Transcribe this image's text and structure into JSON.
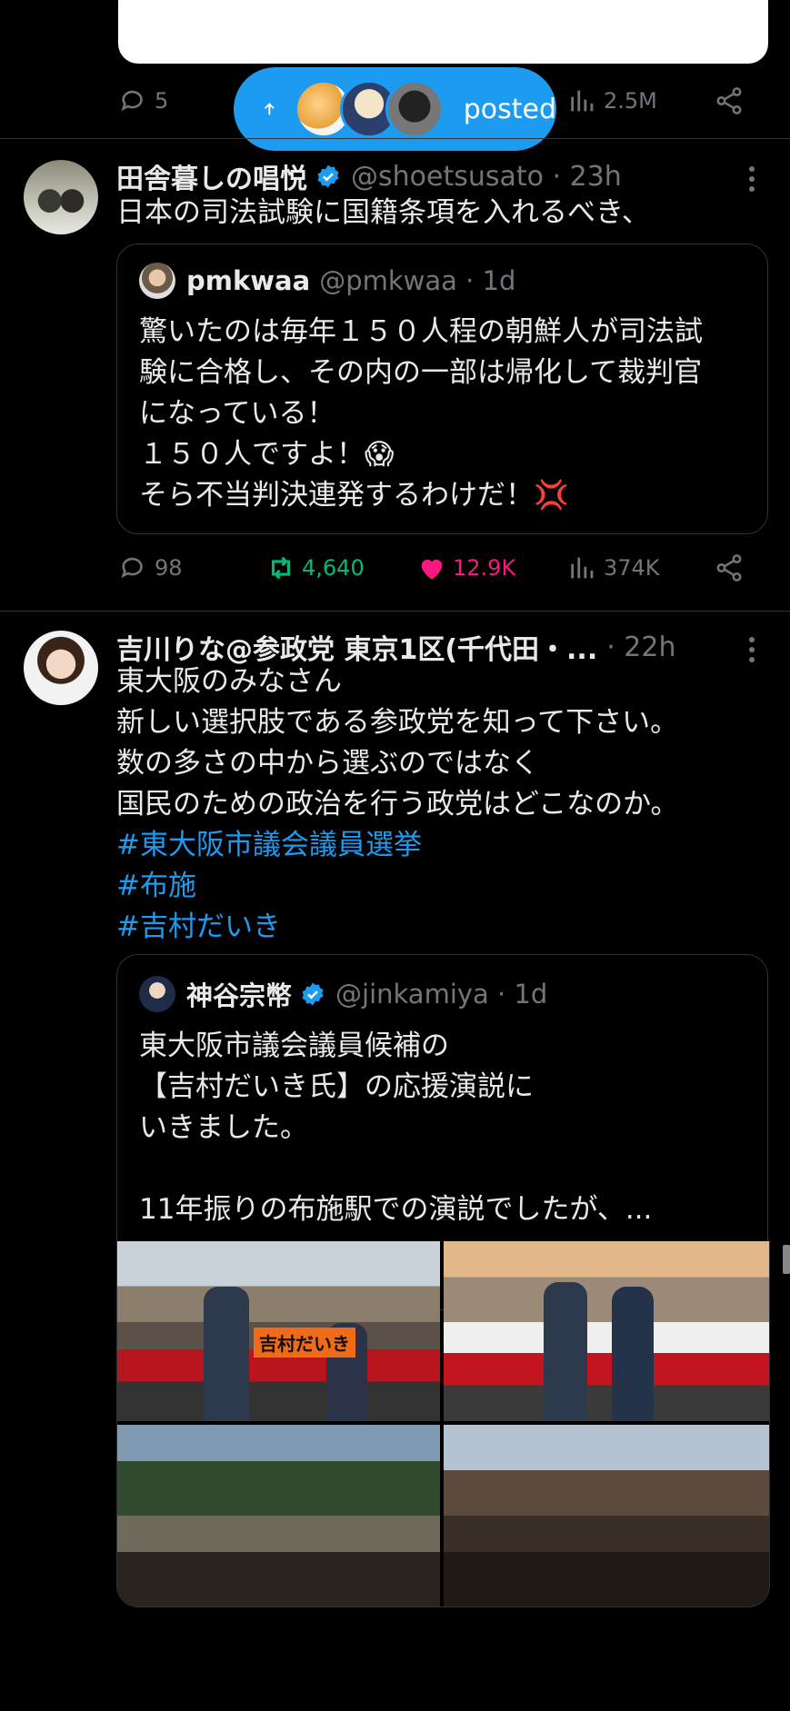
{
  "prev_tweet": {
    "replies": "5",
    "views": "2.5M"
  },
  "posted_pill": {
    "label": "posted",
    "icon": "arrow-up-icon"
  },
  "tweet1": {
    "name": "田舎暮しの唱悦",
    "handle": "@shoetsusato · 23h",
    "text": "日本の司法試験に国籍条項を入れるべき、",
    "quote": {
      "name": "pmkwaa",
      "handle": "@pmkwaa · 1d",
      "text": "驚いたのは毎年１５０人程の朝鮮人が司法試\n験に合格し、その内の一部は帰化して裁判官\nになっている！\n１５０人ですよ！😱\nそら不当判決連発するわけだ！💢"
    },
    "replies": "98",
    "retweets": "4,640",
    "likes": "12.9K",
    "views": "374K"
  },
  "tweet2": {
    "name": "吉川りな@参政党 東京1区(千代田・...",
    "handle": "· 22h",
    "text": "東大阪のみなさん\n新しい選択肢である参政党を知って下さい。\n数の多さの中から選ぶのではなく\n国民のための政治を行う政党はどこなのか。",
    "hashtags": [
      "#東大阪市議会議員選挙",
      "#布施",
      "#吉村だいき"
    ],
    "quote": {
      "name": "神谷宗幣",
      "handle": "@jinkamiya · 1d",
      "text": "東大阪市議会議員候補の\n【吉村だいき氏】の応援演説に\nいきました。\n\n11年振りの布施駅での演説でしたが、..."
    },
    "photo_banner_text": "吉村だいき"
  },
  "colors": {
    "accent": "#1d9bf0",
    "retweet": "#00ba7c",
    "like": "#f91880",
    "muted": "#71767b"
  }
}
